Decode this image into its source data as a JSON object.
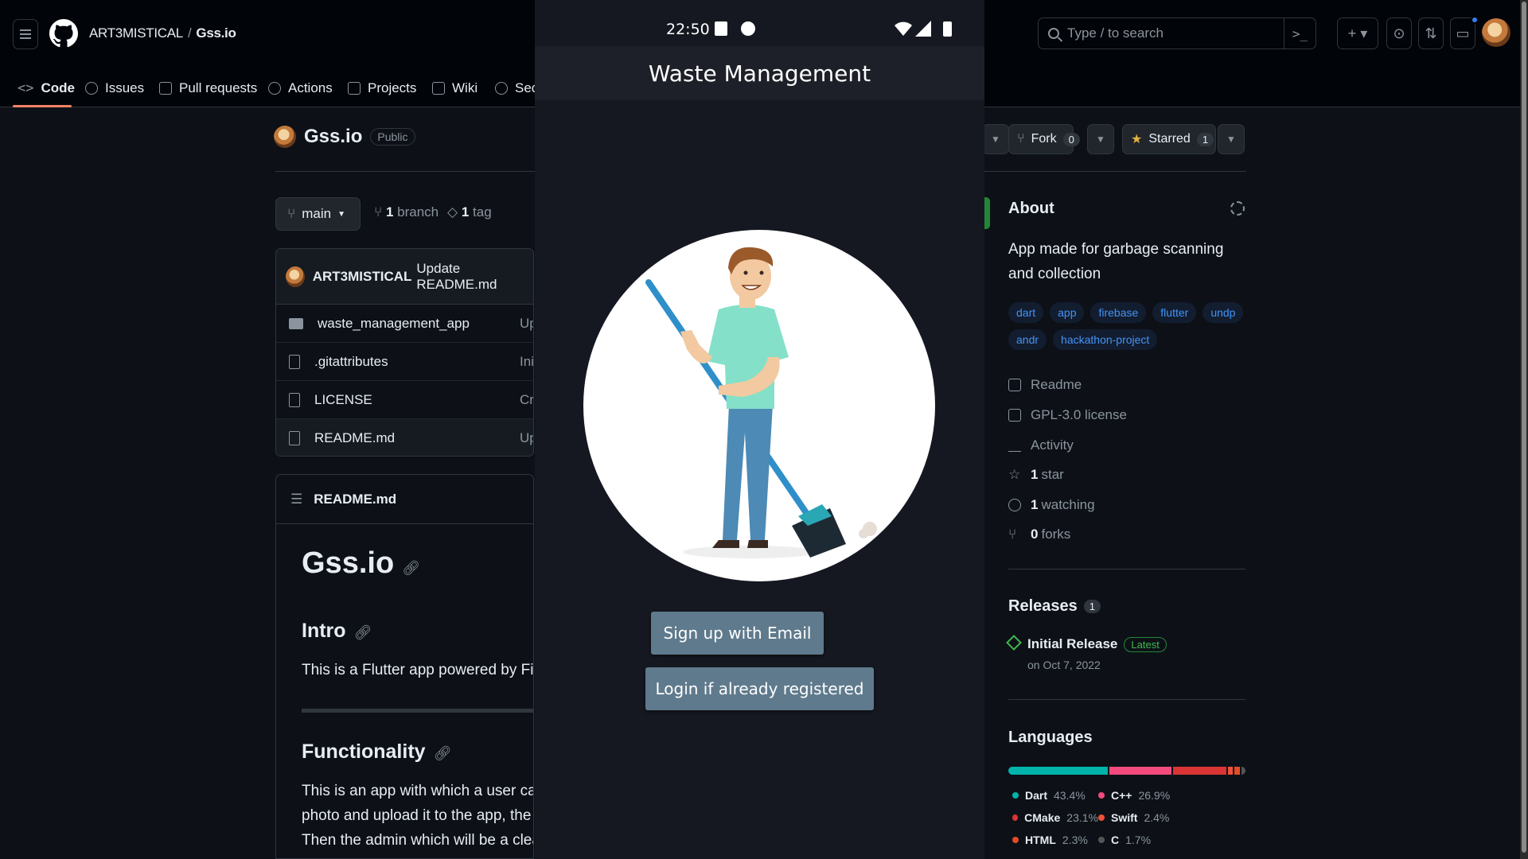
{
  "github": {
    "owner": "ART3MISTICAL",
    "repo": "Gss.io",
    "search_placeholder": "Type / to search",
    "nav": [
      "Code",
      "Issues",
      "Pull requests",
      "Actions",
      "Projects",
      "Wiki",
      "Sec"
    ],
    "visibility": "Public",
    "branch": "main",
    "branch_count": "1",
    "branch_label": "branch",
    "tag_count": "1",
    "tag_label": "tag",
    "commit_author": "ART3MISTICAL",
    "commit_message": "Update README.md",
    "files": [
      {
        "name": "waste_management_app",
        "type": "folder",
        "msg": "Up"
      },
      {
        "name": ".gitattributes",
        "type": "file",
        "msg": "Init"
      },
      {
        "name": "LICENSE",
        "type": "file",
        "msg": "Cre"
      },
      {
        "name": "README.md",
        "type": "file",
        "msg": "Up"
      }
    ],
    "readme": {
      "file_label": "README.md",
      "h1": "Gss.io",
      "intro_heading": "Intro",
      "intro_text": "This is a Flutter app powered by Firebas",
      "func_heading": "Functionality",
      "func_lines": [
        "This is an app with which a user can rep",
        "photo and upload it to the app, the app",
        "Then the admin which will be a cleaning"
      ]
    },
    "fork_label": "Fork",
    "fork_count": "0",
    "starred_label": "Starred",
    "star_count": "1",
    "about": {
      "title": "About",
      "description": "App made for garbage scanning and collection",
      "topics": [
        "dart",
        "app",
        "firebase",
        "flutter",
        "undp",
        "andr",
        "hackathon-project"
      ],
      "readme": "Readme",
      "license": "GPL-3.0 license",
      "activity": "Activity",
      "stars": "1",
      "stars_label": "star",
      "watching": "1",
      "watching_label": "watching",
      "forks": "0",
      "forks_label": "forks"
    },
    "releases": {
      "title": "Releases",
      "count": "1",
      "name": "Initial Release",
      "badge": "Latest",
      "date": "on Oct 7, 2022"
    },
    "languages": {
      "title": "Languages",
      "items": [
        {
          "name": "Dart",
          "pct": "43.4%",
          "value": 43.4,
          "color": "#00B4AB"
        },
        {
          "name": "C++",
          "pct": "26.9%",
          "value": 26.9,
          "color": "#f34b7d"
        },
        {
          "name": "CMake",
          "pct": "23.1%",
          "value": 23.1,
          "color": "#DA3434"
        },
        {
          "name": "Swift",
          "pct": "2.4%",
          "value": 2.4,
          "color": "#F05138"
        },
        {
          "name": "HTML",
          "pct": "2.3%",
          "value": 2.3,
          "color": "#e34c26"
        },
        {
          "name": "C",
          "pct": "1.7%",
          "value": 1.7,
          "color": "#555555"
        }
      ]
    }
  },
  "phone": {
    "time": "22:50",
    "app_title": "Waste Management",
    "signup_label": "Sign up with Email",
    "login_label": "Login if already registered"
  }
}
